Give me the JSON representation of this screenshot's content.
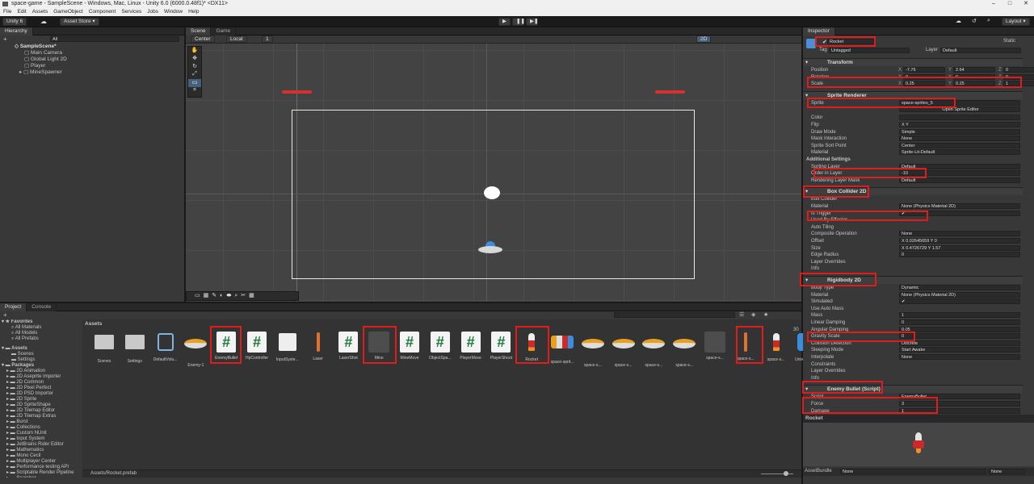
{
  "title": "space-game - SampleScene - Windows, Mac, Linux - Unity 6.0 (6000.0.48f1)* <DX11>",
  "window_controls": [
    "–",
    "□",
    "✕"
  ],
  "menu": [
    "File",
    "Edit",
    "Assets",
    "GameObject",
    "Component",
    "Services",
    "Jobs",
    "Window",
    "Help"
  ],
  "toolbar": {
    "account": "Unity 6",
    "asset_store": "Asset Store ▾",
    "layout": "Layout ▾"
  },
  "hierarchy": {
    "tab": "Hierarchy",
    "search": "All",
    "scene": "SampleScene*",
    "items": [
      "Main Camera",
      "Global Light 2D",
      "Player",
      "MineSpawner"
    ]
  },
  "scene": {
    "tabs": [
      "Scene",
      "Game"
    ],
    "pivot": "Center",
    "space": "Local",
    "grid": "1",
    "mode2d": "2D"
  },
  "project": {
    "tabs": [
      "Project",
      "Console"
    ],
    "path_title": "Assets",
    "breadcrumb": "Assets/Rocket.prefab",
    "zoom": "30",
    "favorites": {
      "title": "Favorites",
      "items": [
        "All Materials",
        "All Models",
        "All Prefabs"
      ]
    },
    "assets_root": {
      "title": "Assets",
      "items": [
        "Scenes",
        "Settings"
      ]
    },
    "packages": {
      "title": "Packages",
      "items": [
        "2D Animation",
        "2D Aseprite Importer",
        "2D Common",
        "2D Pixel Perfect",
        "2D PSD Importer",
        "2D Sprite",
        "2D SpriteShape",
        "2D Tilemap Editor",
        "2D Tilemap Extras",
        "Burst",
        "Collections",
        "Custom NUnit",
        "Input System",
        "JetBrains Rider Editor",
        "Mathematics",
        "Mono Cecil",
        "Multiplayer Center",
        "Performance testing API",
        "Scriptable Render Pipeline",
        "Searcher"
      ]
    },
    "assets": [
      {
        "label": "Scenes",
        "type": "folder"
      },
      {
        "label": "Settings",
        "type": "folder"
      },
      {
        "label": "DefaultVolu...",
        "type": "cube"
      },
      {
        "label": "Enemy-1",
        "type": "ufo"
      },
      {
        "label": "EnemyBullet",
        "type": "script"
      },
      {
        "label": "HpController",
        "type": "script"
      },
      {
        "label": "InputSyste...",
        "type": "map"
      },
      {
        "label": "Laser",
        "type": "laser"
      },
      {
        "label": "LaserShot",
        "type": "script"
      },
      {
        "label": "Mine",
        "type": "mine"
      },
      {
        "label": "MineMove",
        "type": "script"
      },
      {
        "label": "ObjectSpa...",
        "type": "script"
      },
      {
        "label": "PlayerMove",
        "type": "script"
      },
      {
        "label": "PlayerShoot",
        "type": "script"
      },
      {
        "label": "Rocket",
        "type": "rocket"
      },
      {
        "label": "space-sprit...",
        "type": "sheet"
      },
      {
        "label": "space-s...",
        "type": "ufo"
      },
      {
        "label": "space-s...",
        "type": "ufo"
      },
      {
        "label": "space-s...",
        "type": "ufo"
      },
      {
        "label": "space-s...",
        "type": "ufo"
      },
      {
        "label": "space-s...",
        "type": "mine"
      },
      {
        "label": "space-s...",
        "type": "laser"
      },
      {
        "label": "space-s...",
        "type": "rocket"
      },
      {
        "label": "UniversalR...",
        "type": "gear"
      }
    ]
  },
  "inspector": {
    "tab": "Inspector",
    "name": "Rocket",
    "static": "Static",
    "tag_label": "Tag",
    "tag": "Untagged",
    "layer_label": "Layer",
    "layer": "Default",
    "transform": {
      "title": "Transform",
      "position": [
        "-7.76",
        "2.64",
        "0"
      ],
      "rotation": [
        "0",
        "0",
        "0"
      ],
      "scale": [
        "0.25",
        "0.25",
        "1"
      ],
      "labels": [
        "Position",
        "Rotation",
        "Scale"
      ]
    },
    "sprite_renderer": {
      "title": "Sprite Renderer",
      "sprite": "space-sprites_5",
      "open_editor": "Open Sprite Editor",
      "rows": [
        [
          "Color",
          ""
        ],
        [
          "Flip",
          "X   Y"
        ],
        [
          "Draw Mode",
          "Simple"
        ],
        [
          "Mask Interaction",
          "None"
        ],
        [
          "Sprite Sort Point",
          "Center"
        ],
        [
          "Material",
          "Sprite-Lit-Default"
        ]
      ],
      "additional": "Additional Settings",
      "sorting_layer": [
        "Sorting Layer",
        "Default"
      ],
      "order": [
        "Order in Layer",
        "-10"
      ],
      "rendering": [
        "Rendering Layer Mask",
        "Default"
      ]
    },
    "box_collider": {
      "title": "Box Collider 2D",
      "rows": [
        [
          "Edit Collider",
          ""
        ],
        [
          "Material",
          "None (Physics Material 2D)"
        ],
        [
          "Is Trigger",
          "✔"
        ],
        [
          "Used By Effector",
          ""
        ],
        [
          "Auto Tiling",
          ""
        ],
        [
          "Composite Operation",
          "None"
        ],
        [
          "Offset",
          "X 0.02645659   Y 0"
        ],
        [
          "Size",
          "X 0.4726729   Y 1.57"
        ],
        [
          "Edge Radius",
          "0"
        ],
        [
          "Layer Overrides",
          ""
        ],
        [
          "Info",
          ""
        ]
      ]
    },
    "rigidbody": {
      "title": "Rigidbody 2D",
      "rows": [
        [
          "Body Type",
          "Dynamic"
        ],
        [
          "Material",
          "None (Physics Material 2D)"
        ],
        [
          "Simulated",
          "✔"
        ],
        [
          "Use Auto Mass",
          ""
        ],
        [
          "Mass",
          "1"
        ],
        [
          "Linear Damping",
          "0"
        ],
        [
          "Angular Damping",
          "0.05"
        ],
        [
          "Gravity Scale",
          "0"
        ],
        [
          "Collision Detection",
          "Discrete"
        ],
        [
          "Sleeping Mode",
          "Start Awake"
        ],
        [
          "Interpolate",
          "None"
        ],
        [
          "Constraints",
          ""
        ],
        [
          "Layer Overrides",
          ""
        ],
        [
          "Info",
          ""
        ]
      ]
    },
    "enemy_bullet": {
      "title": "Enemy Bullet (Script)",
      "script_label": "Script",
      "script": "EnemyBullet",
      "rows": [
        [
          "Force",
          "3"
        ],
        [
          "Damage",
          "1"
        ]
      ]
    },
    "preview_title": "Rocket",
    "assetbundle": "AssetBundle",
    "bundle": "None",
    "variant": "None"
  }
}
